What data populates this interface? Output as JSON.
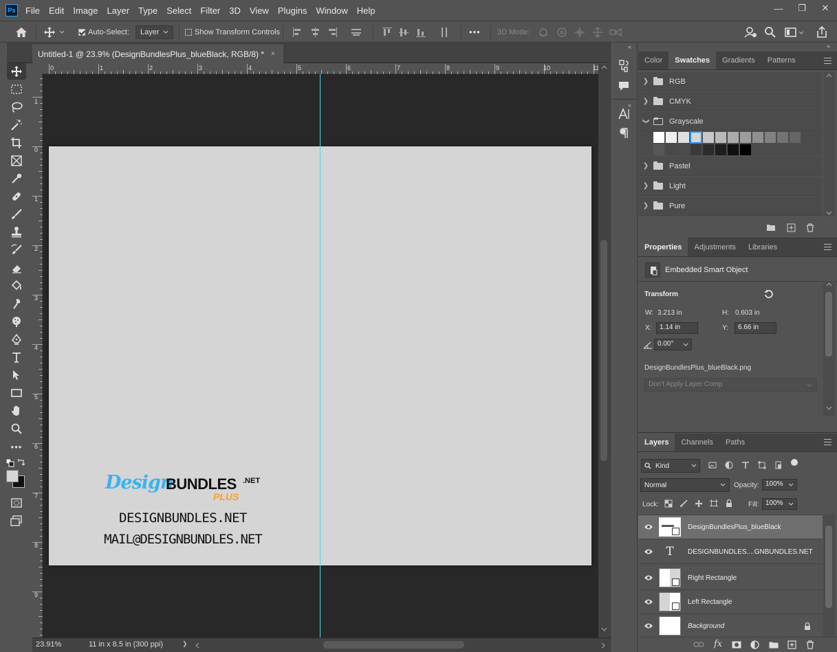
{
  "app": {
    "logo": "Ps"
  },
  "menu": [
    "File",
    "Edit",
    "Image",
    "Layer",
    "Type",
    "Select",
    "Filter",
    "3D",
    "View",
    "Plugins",
    "Window",
    "Help"
  ],
  "window_controls": {
    "minimize": "—",
    "restore": "❐",
    "close": "✕"
  },
  "options": {
    "auto_select_label": "Auto-Select:",
    "auto_select_target": "Layer",
    "show_transform_label": "Show Transform Controls",
    "three_d_mode_label": "3D Mode:",
    "more": "•••"
  },
  "document": {
    "tab_title": "Untitled-1 @ 23.9% (DesignBundlesPlus_blueBlack, RGB/8) *",
    "close": "×",
    "zoom": "23.91%",
    "doc_size": "11 in x 8.5 in (300 ppi)",
    "status_arrow": "❯"
  },
  "rulers": {
    "h": [
      "0",
      "1",
      "2",
      "3",
      "4",
      "5",
      "6",
      "7",
      "8",
      "9",
      "10",
      "11"
    ],
    "v": [
      "1",
      "0",
      "1",
      "2",
      "3",
      "4",
      "5",
      "6",
      "7",
      "8",
      "9"
    ]
  },
  "artwork": {
    "logo_design": "Design",
    "logo_bundles": "BUNDLES",
    "logo_net": ".NET",
    "logo_plus": "PLUS",
    "line1": "DESIGNBUNDLES.NET",
    "line2": "MAIL@DESIGNBUNDLES.NET",
    "logo_blue": "#3cb3f0",
    "logo_orange": "#f7a21b"
  },
  "swatches_panel": {
    "tabs": [
      "Color",
      "Swatches",
      "Gradients",
      "Patterns"
    ],
    "active_tab": "Swatches",
    "groups": [
      "RGB",
      "CMYK",
      "Grayscale",
      "Pastel",
      "Light",
      "Pure"
    ],
    "grayscale_row1": [
      "#ffffff",
      "#efefef",
      "#e0e0e0",
      "#d6d6d6",
      "#c8c8c8",
      "#bababa",
      "#ababab",
      "#9d9d9d",
      "#8f8f8f",
      "#818181",
      "#737373",
      "#656565"
    ],
    "grayscale_row2": [
      "#575757",
      "#494949",
      "#3a3a3a",
      "#2c2c2c",
      "#1e1e1e",
      "#101010",
      "#000000"
    ]
  },
  "properties_panel": {
    "tabs": [
      "Properties",
      "Adjustments",
      "Libraries"
    ],
    "active_tab": "Properties",
    "object_type": "Embedded Smart Object",
    "section": "Transform",
    "w_label": "W:",
    "w_value": "3.213 in",
    "h_label": "H:",
    "h_value": "0.603 in",
    "x_label": "X:",
    "x_value": "1.14 in",
    "y_label": "Y:",
    "y_value": "6.66 in",
    "angle_value": "0.00°",
    "filename": "DesignBundlesPlus_blueBlack.png",
    "layer_comp": "Don't Apply Layer Comp"
  },
  "layers_panel": {
    "tabs": [
      "Layers",
      "Channels",
      "Paths"
    ],
    "active_tab": "Layers",
    "filter_kind": "Kind",
    "blend_mode": "Normal",
    "opacity_label": "Opacity:",
    "opacity": "100%",
    "lock_label": "Lock:",
    "fill_label": "Fill:",
    "fill": "100%",
    "layers": [
      {
        "name": "DesignBundlesPlus_blueBlack",
        "selected": true
      },
      {
        "name": "DESIGNBUNDLES....GNBUNDLES.NET",
        "type_glyph": "T"
      },
      {
        "name": "Right Rectangle"
      },
      {
        "name": "Left Rectangle"
      },
      {
        "name": "Background"
      }
    ],
    "fx_label": "fx"
  }
}
